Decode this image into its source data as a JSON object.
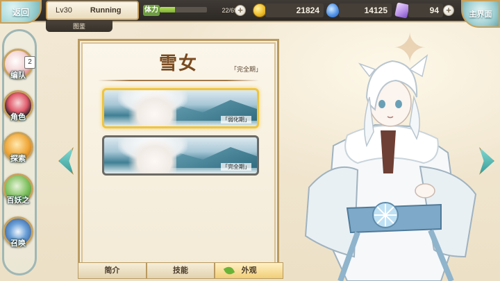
{
  "header": {
    "back_label": "返回",
    "level": "Lv30",
    "status": "Running",
    "sub_tab": "图鉴",
    "stamina_label": "体力",
    "stamina_text": "22/69",
    "stamina_fraction": 0.32,
    "gold": "21824",
    "soul": "14125",
    "crystal": "94",
    "main_label": "主界面"
  },
  "sidebar": {
    "items": [
      {
        "label": "编队",
        "badge": "2"
      },
      {
        "label": "角色"
      },
      {
        "label": "探索"
      },
      {
        "label": "百妖之"
      },
      {
        "label": "召唤"
      }
    ]
  },
  "panel": {
    "title": "雪女",
    "stage_tag": "「完全期」",
    "cards": [
      {
        "tag": "「弱化期」"
      },
      {
        "tag": "「完全期」"
      }
    ]
  },
  "tabs": [
    {
      "label": "简介"
    },
    {
      "label": "技能"
    },
    {
      "label": "外观"
    }
  ],
  "colors": {
    "accent_gold": "#c9a05a",
    "selected_border": "#f0c43c",
    "title_brown": "#7a4a1f",
    "stamina_green": "#7db332"
  }
}
